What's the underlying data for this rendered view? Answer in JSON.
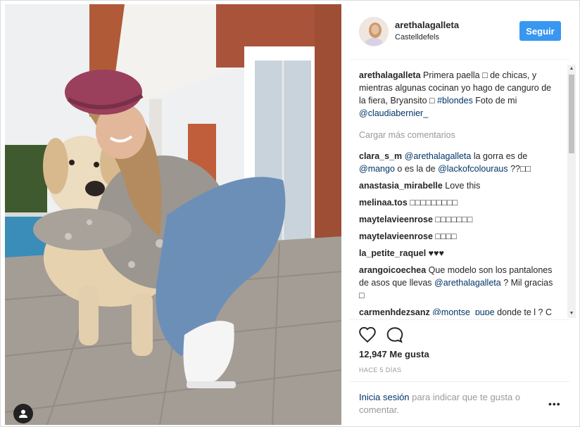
{
  "post": {
    "username": "arethalagalleta",
    "location": "Castelldefels",
    "follow_label": "Seguir",
    "caption_user": "arethalagalleta",
    "caption_text_1": " Primera paella □ de chicas, y mientras algunas cocinan yo hago de canguro de la fiera, Bryansito □ ",
    "caption_hashtag": "#blondes",
    "caption_text_2": " Foto de mi ",
    "caption_mention": "@claudiabernier_",
    "load_more": "Cargar más comentarios",
    "likes": "12,947 Me gusta",
    "time_ago": "HACE 5 DÍAS",
    "login_link": "Inicia sesión",
    "login_text": " para indicar que te gusta o comentar.",
    "more_label": "•••"
  },
  "comments": [
    {
      "user": "clara_s_m",
      "parts": [
        " ",
        "@arethalagalleta",
        " la gorra es de ",
        "@mango",
        " o es la de ",
        "@lackofcolouraus",
        " ??□□"
      ]
    },
    {
      "user": "anastasia_mirabelle",
      "parts": [
        " Love this"
      ]
    },
    {
      "user": "melinaa.tos",
      "parts": [
        " □□□□□□□□□"
      ]
    },
    {
      "user": "maytelavieenrose",
      "parts": [
        " □□□□□□□"
      ]
    },
    {
      "user": "maytelavieenrose",
      "parts": [
        " □□□□"
      ]
    },
    {
      "user": "la_petite_raquel",
      "parts": [
        " ♥♥♥"
      ]
    },
    {
      "user": "arangoicoechea",
      "parts": [
        " Que modelo son los pantalones de asos que llevas ",
        "@arethalagalleta",
        " ? Mil gracias □"
      ]
    },
    {
      "user": "carmenhdezsanz",
      "parts": [
        " ",
        "@montse_pupe",
        " donde te",
        " l",
        "",
        " ",
        " ",
        "   ?  C",
        "",
        ""
      ]
    }
  ],
  "icons": {
    "like": "heart-icon",
    "comment": "comment-icon",
    "photo_tag": "user-icon",
    "scroll_up": "▲",
    "scroll_down": "▼"
  },
  "colors": {
    "accent": "#3897f0",
    "link": "#003569",
    "muted": "#999999"
  }
}
